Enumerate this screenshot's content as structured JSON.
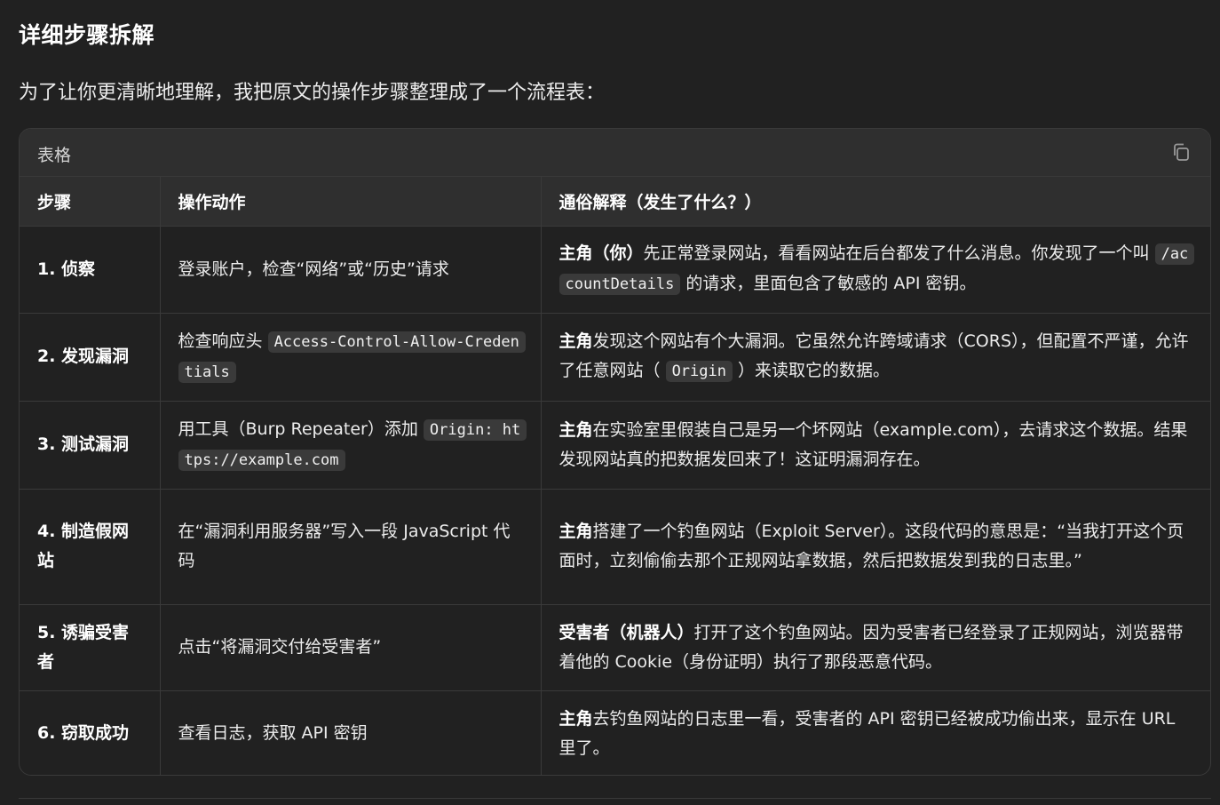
{
  "heading": "详细步骤拆解",
  "intro": "为了让你更清晰地理解，我把原文的操作步骤整理成了一个流程表：",
  "table": {
    "title": "表格",
    "copy_icon": "copy-icon",
    "headers": [
      "步骤",
      "操作动作",
      "通俗解释（发生了什么？）"
    ],
    "rows": [
      {
        "step": "1. 侦察",
        "action": "登录账户，检查“网络”或“历史”请求",
        "explain_bold": "主角（你）",
        "explain_pre": "先正常登录网站，看看网站在后台都发了什么消息。你发现了一个叫",
        "explain_code": "/accountDetails",
        "explain_post": "的请求，里面包含了敏感的 API 密钥。"
      },
      {
        "step": "2. 发现漏洞",
        "action_pre": "检查响应头",
        "action_code": "Access-Control-Allow-Credentials",
        "explain_bold": "主角",
        "explain_pre": "发现这个网站有个大漏洞。它虽然允许跨域请求（CORS），但配置不严谨，允许了任意网站（",
        "explain_code": "Origin",
        "explain_post": "）来读取它的数据。"
      },
      {
        "step": "3. 测试漏洞",
        "action_pre": "用工具（Burp Repeater）添加",
        "action_code": "Origin: https://example.com",
        "explain_bold": "主角",
        "explain_pre": "在实验室里假装自己是另一个坏网站（example.com），去请求这个数据。结果发现网站真的把数据发回来了！这证明漏洞存在。"
      },
      {
        "step": "4. 制造假网站",
        "action": "在“漏洞利用服务器”写入一段 JavaScript 代码",
        "explain_bold": "主角",
        "explain_pre": "搭建了一个钓鱼网站（Exploit Server）。这段代码的意思是：“当我打开这个页面时，立刻偷偷去那个正规网站拿数据，然后把数据发到我的日志里。”"
      },
      {
        "step": "5. 诱骗受害者",
        "action": "点击“将漏洞交付给受害者”",
        "explain_bold": "受害者（机器人）",
        "explain_pre": "打开了这个钓鱼网站。因为受害者已经登录了正规网站，浏览器带着他的 Cookie（身份证明）执行了那段恶意代码。"
      },
      {
        "step": "6. 窃取成功",
        "action": "查看日志，获取 API 密钥",
        "explain_bold": "主角",
        "explain_pre": "去钓鱼网站的日志里一看，受害者的 API 密钥已经被成功偷出来，显示在 URL 里了。"
      }
    ]
  }
}
